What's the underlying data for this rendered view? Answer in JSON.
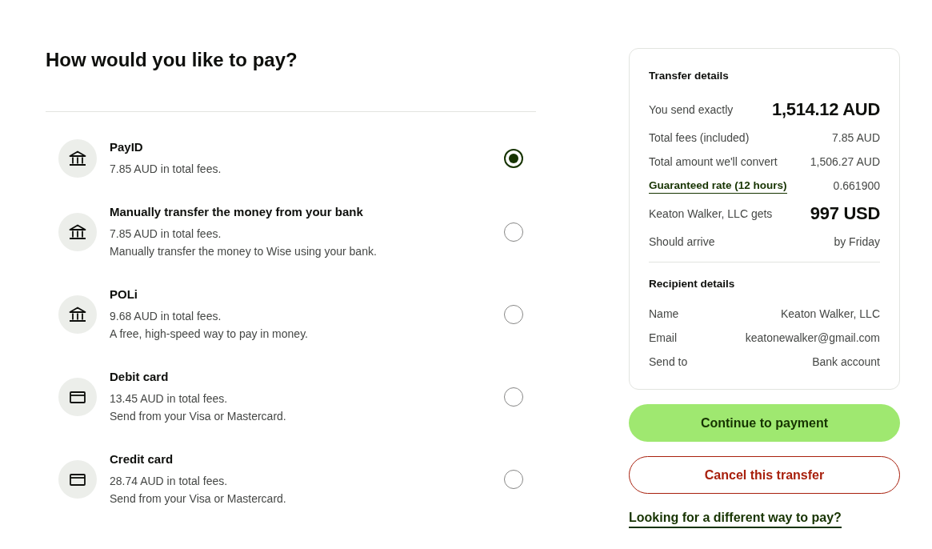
{
  "heading": "How would you like to pay?",
  "payment_methods": [
    {
      "kind": "bank",
      "title": "PayID",
      "fee": "7.85 AUD in total fees.",
      "selected": true
    },
    {
      "kind": "bank",
      "title": "Manually transfer the money from your bank",
      "fee": "7.85 AUD in total fees.",
      "description": "Manually transfer the money to Wise using your bank.",
      "selected": false
    },
    {
      "kind": "bank",
      "title": "POLi",
      "fee": "9.68 AUD in total fees.",
      "description": "A free, high-speed way to pay in money.",
      "selected": false
    },
    {
      "kind": "card",
      "title": "Debit card",
      "fee": "13.45 AUD in total fees.",
      "description": "Send from your Visa or Mastercard.",
      "selected": false
    },
    {
      "kind": "card",
      "title": "Credit card",
      "fee": "28.74 AUD in total fees.",
      "description": "Send from your Visa or Mastercard.",
      "selected": false
    }
  ],
  "transfer_details": {
    "title": "Transfer details",
    "rows": [
      {
        "kind": "large",
        "label": "You send exactly",
        "value": "1,514.12 AUD"
      },
      {
        "kind": "plain",
        "label": "Total fees (included)",
        "value": "7.85 AUD"
      },
      {
        "kind": "plain",
        "label": "Total amount we'll convert",
        "value": "1,506.27 AUD"
      },
      {
        "kind": "link",
        "label": "Guaranteed rate (12 hours)",
        "value": "0.661900"
      },
      {
        "kind": "large",
        "label": "Keaton Walker, LLC gets",
        "value": "997 USD"
      },
      {
        "kind": "plain",
        "label": "Should arrive",
        "value": "by Friday"
      }
    ]
  },
  "recipient_details": {
    "title": "Recipient details",
    "rows": [
      {
        "kind": "plain",
        "label": "Name",
        "value": "Keaton Walker, LLC"
      },
      {
        "kind": "plain",
        "label": "Email",
        "value": "keatonewalker@gmail.com"
      },
      {
        "kind": "plain",
        "label": "Send to",
        "value": "Bank account"
      }
    ]
  },
  "buttons": [
    {
      "kind": "primary",
      "label": "Continue to payment"
    },
    {
      "kind": "danger",
      "label": "Cancel this transfer"
    }
  ],
  "alternative_link": "Looking for a different way to pay?"
}
